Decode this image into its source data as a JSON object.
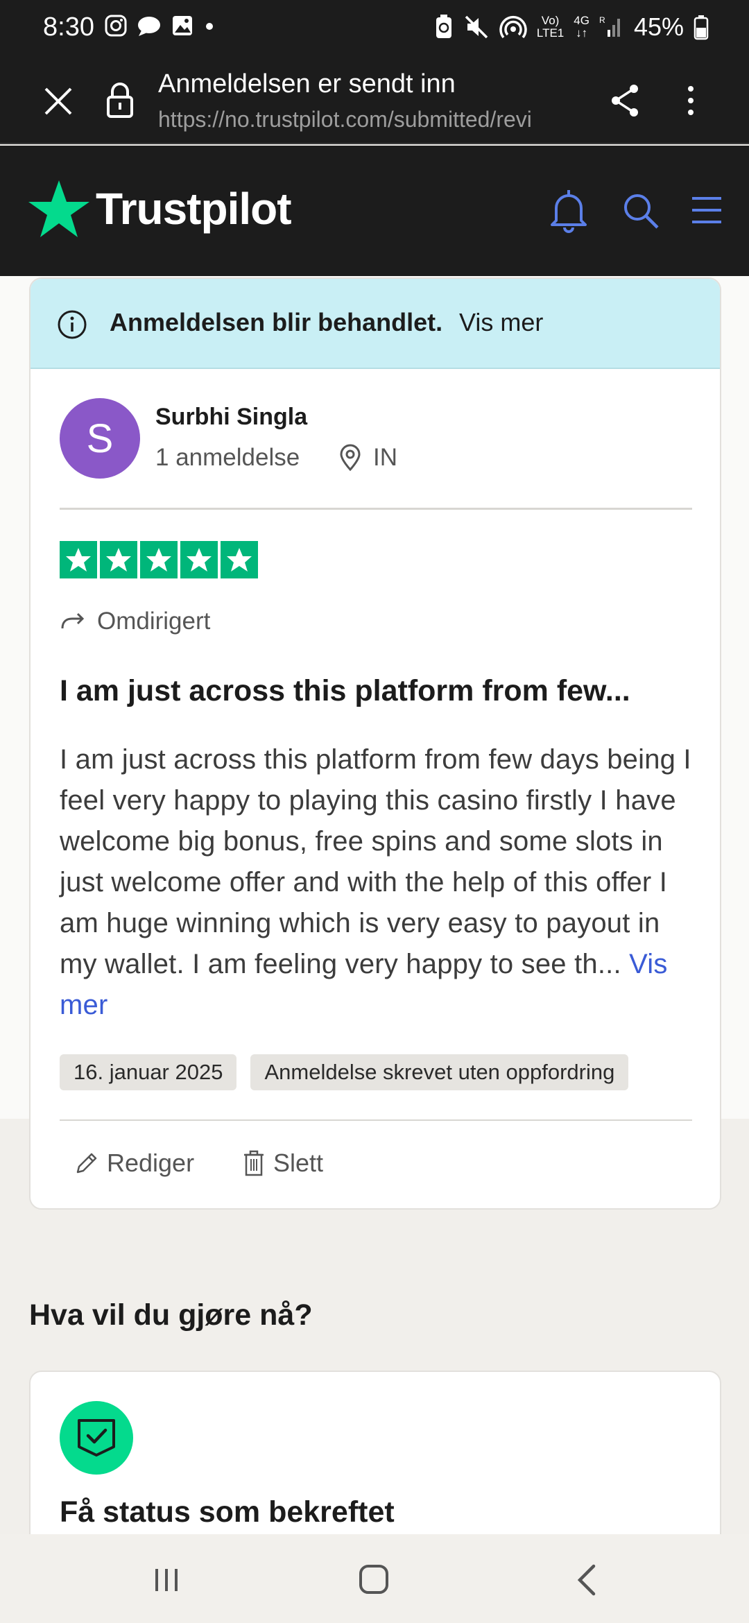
{
  "status_bar": {
    "time": "8:30",
    "battery": "45%",
    "network_top": "Vo)",
    "network_bottom": "LTE1",
    "gen_top": "4G",
    "gen_bottom": "R"
  },
  "browser": {
    "title": "Anmeldelsen er sendt inn",
    "url": "https://no.trustpilot.com/submitted/revi"
  },
  "header": {
    "logo_text": "Trustpilot",
    "brand_green": "#00b67a"
  },
  "notice": {
    "text": "Anmeldelsen blir behandlet.",
    "link": "Vis mer",
    "bg_color": "#c9eff5"
  },
  "review": {
    "avatar_initial": "S",
    "avatar_color": "#8a58c8",
    "reviewer_name": "Surbhi Singla",
    "review_count": "1 anmeldelse",
    "location": "IN",
    "rating": 5,
    "rating_max": 5,
    "redirect_label": "Omdirigert",
    "title": "I am just across this platform from few...",
    "body": "I am just across this platform from few days being I feel very happy to playing this casino firstly I have welcome big bonus, free spins and some slots in just welcome offer and with the help of this offer I am huge winning which is very easy to payout in my wallet. I am feeling very happy to see th...",
    "read_more": "Vis mer",
    "date_tag": "16. januar 2025",
    "type_tag": "Anmeldelse skrevet uten oppfordring",
    "edit_label": "Rediger",
    "delete_label": "Slett"
  },
  "next_steps": {
    "heading": "Hva vil du gjøre nå?",
    "card_title": "Få status som bekreftet"
  },
  "icons": {
    "close": "close-icon",
    "lock": "lock-icon",
    "share": "share-icon",
    "more": "more-vertical-icon",
    "bell": "bell-icon",
    "search": "search-icon",
    "menu": "menu-icon",
    "info": "info-icon",
    "location": "location-pin-icon",
    "redirect": "redirect-arrow-icon",
    "edit": "pencil-icon",
    "delete": "trash-icon",
    "verified": "shield-check-icon"
  }
}
